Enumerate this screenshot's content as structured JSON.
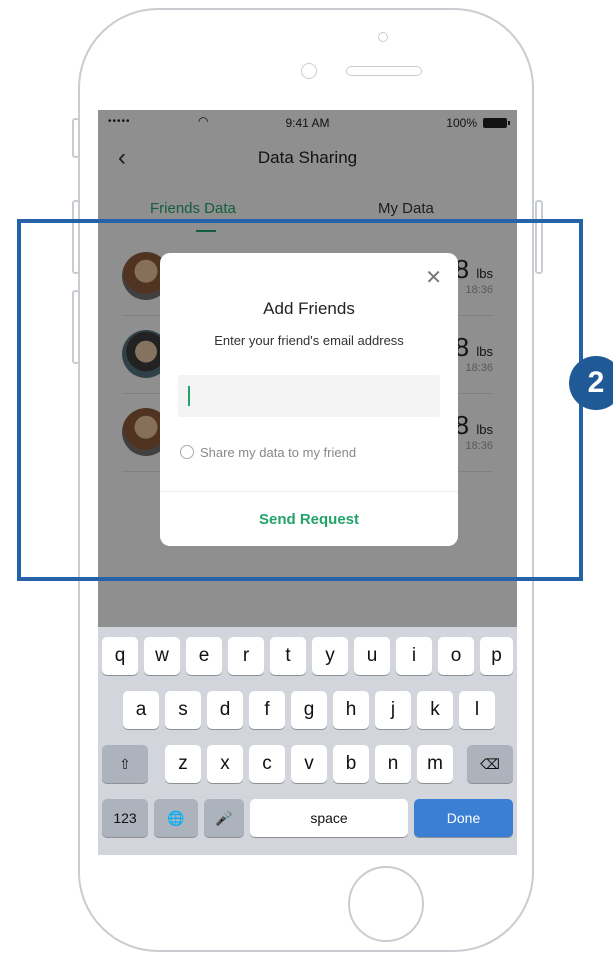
{
  "status_bar": {
    "signal": "•••••",
    "wifi_icon": "wifi-icon",
    "time": "9:41 AM",
    "battery_pct": "100%"
  },
  "nav": {
    "back_icon": "chevron-left-icon",
    "title": "Data Sharing"
  },
  "tabs": [
    {
      "label": "Friends Data",
      "active": true
    },
    {
      "label": "My Data",
      "active": false
    }
  ],
  "friends": [
    {
      "weight": "8",
      "unit": "lbs",
      "time": "18:36"
    },
    {
      "weight": "8",
      "unit": "lbs",
      "time": "18:36"
    },
    {
      "weight": "8",
      "unit": "lbs",
      "time": "18:36"
    }
  ],
  "dialog": {
    "title": "Add Friends",
    "subtitle": "Enter your friend's email address",
    "email_value": "",
    "share_label": "Share my data to my friend",
    "send_label": "Send Request",
    "close_icon": "close-icon"
  },
  "keyboard": {
    "row1": [
      "q",
      "w",
      "e",
      "r",
      "t",
      "y",
      "u",
      "i",
      "o",
      "p"
    ],
    "row2": [
      "a",
      "s",
      "d",
      "f",
      "g",
      "h",
      "j",
      "k",
      "l"
    ],
    "row3": [
      "z",
      "x",
      "c",
      "v",
      "b",
      "n",
      "m"
    ],
    "numbers": "123",
    "space": "space",
    "done": "Done"
  },
  "annotation": {
    "badge": "2",
    "color": "#2563a8"
  },
  "colors": {
    "accent": "#23a36a",
    "done_key": "#3b7fd5"
  }
}
